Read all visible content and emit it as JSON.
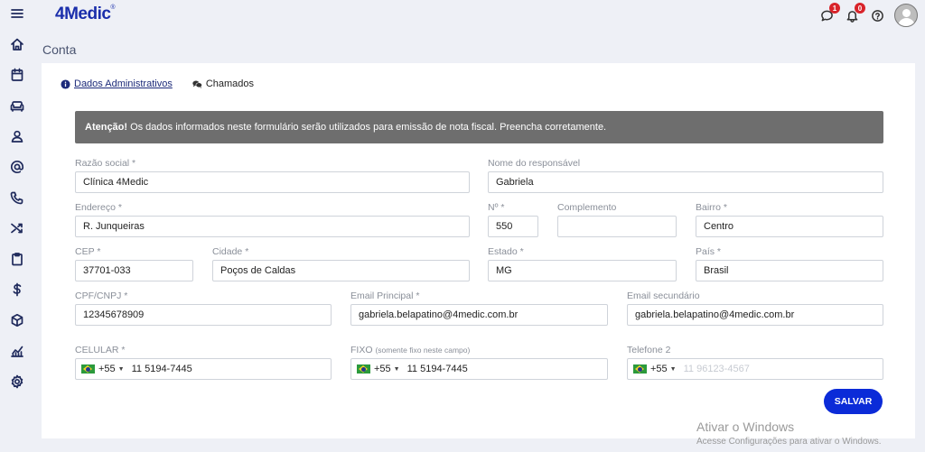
{
  "app": {
    "logo_text": "4Medic",
    "logo_reg": "®"
  },
  "header": {
    "messages_badge": "1",
    "notifications_badge": "0"
  },
  "page": {
    "title": "Conta"
  },
  "tabs": [
    {
      "label": "Dados Administrativos",
      "icon": "info-circle-icon",
      "active": true
    },
    {
      "label": "Chamados",
      "icon": "chat-bubbles-icon",
      "active": false
    }
  ],
  "alert": {
    "strong": "Atenção!",
    "text": "Os dados informados neste formulário serão utilizados para emissão de nota fiscal. Preencha corretamente."
  },
  "form": {
    "razao_social": {
      "label": "Razão social *",
      "value": "Clínica 4Medic"
    },
    "responsavel": {
      "label": "Nome do responsável",
      "value": "Gabriela"
    },
    "endereco": {
      "label": "Endereço *",
      "value": "R. Junqueiras"
    },
    "numero": {
      "label": "Nº *",
      "value": "550"
    },
    "complemento": {
      "label": "Complemento",
      "value": ""
    },
    "bairro": {
      "label": "Bairro *",
      "value": "Centro"
    },
    "cep": {
      "label": "CEP *",
      "value": "37701-033"
    },
    "cidade": {
      "label": "Cidade *",
      "value": "Poços de Caldas"
    },
    "estado": {
      "label": "Estado *",
      "value": "MG"
    },
    "pais": {
      "label": "País *",
      "value": "Brasil"
    },
    "cpf_cnpj": {
      "label": "CPF/CNPJ *",
      "value": "12345678909"
    },
    "email_principal": {
      "label": "Email Principal *",
      "value": "gabriela.belapatino@4medic.com.br"
    },
    "email_secundario": {
      "label": "Email secundário",
      "value": "gabriela.belapatino@4medic.com.br"
    },
    "celular": {
      "label": "CELULAR *",
      "code": "+55",
      "value": "11 5194-7445"
    },
    "fixo": {
      "label": "FIXO",
      "label_note": "(somente fixo neste campo)",
      "code": "+55",
      "value": "11 5194-7445"
    },
    "telefone2": {
      "label": "Telefone 2",
      "code": "+55",
      "placeholder": "11 96123-4567"
    }
  },
  "actions": {
    "save_label": "SALVAR"
  },
  "watermark": {
    "title": "Ativar o Windows",
    "subtitle": "Acesse Configurações para ativar o Windows."
  },
  "colors": {
    "brand": "#1a2eab",
    "save": "#0b2bd8",
    "alert_bg": "#6e6e6e",
    "badge": "#d8232a"
  }
}
